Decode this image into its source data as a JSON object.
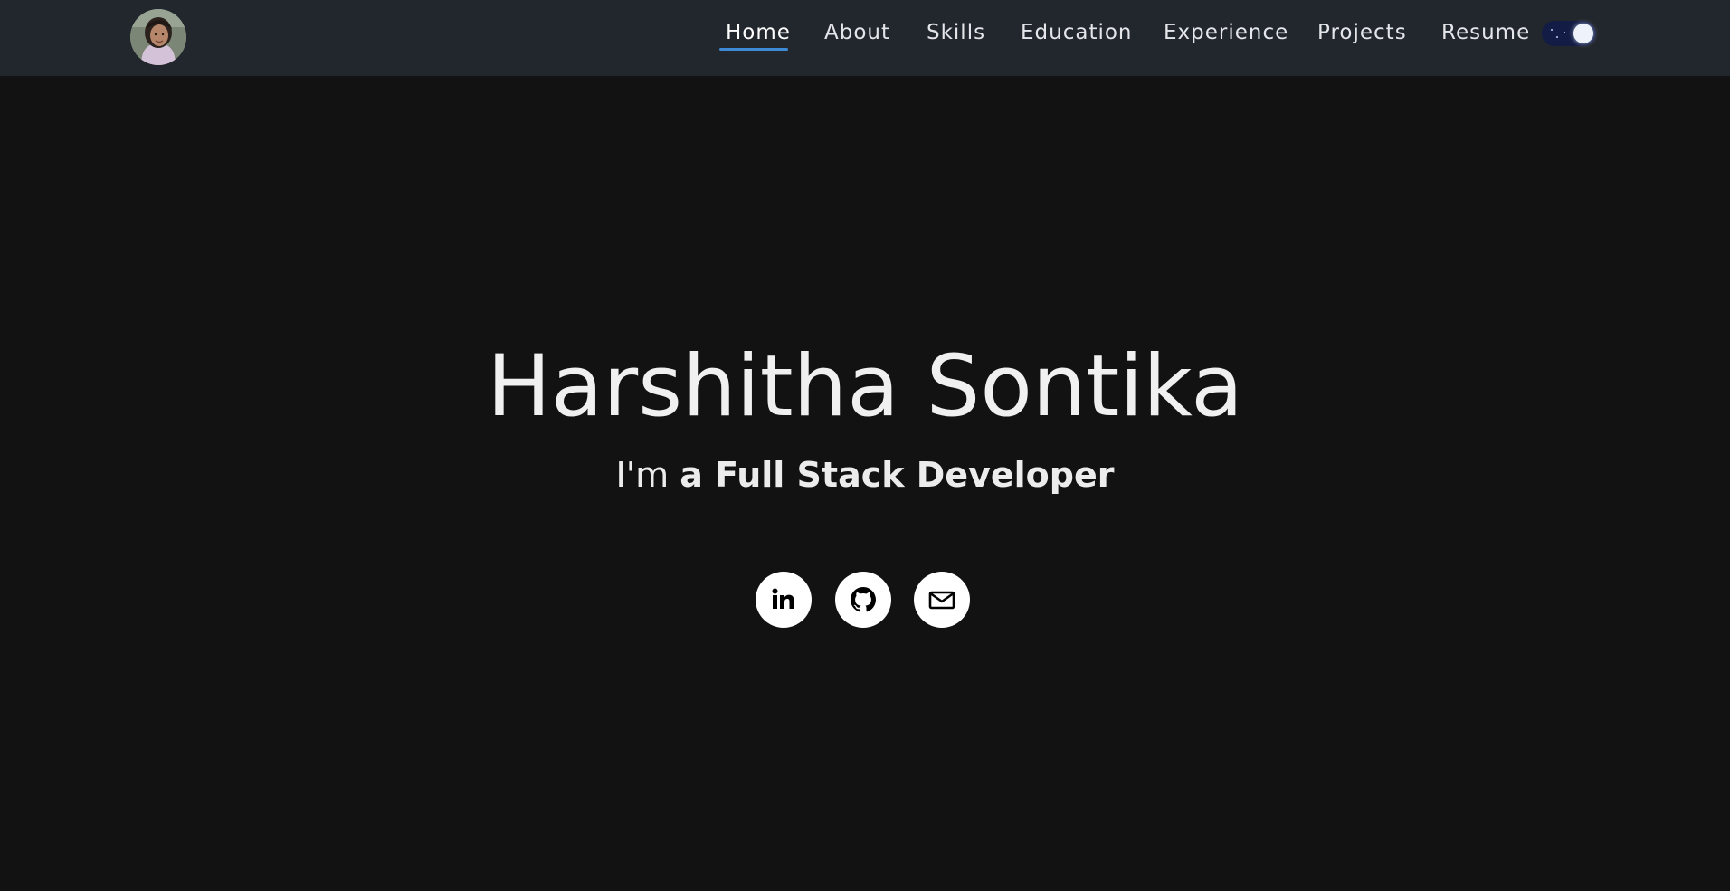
{
  "navbar": {
    "avatar_alt": "Harshitha Sontika profile photo",
    "links": [
      {
        "label": "Home",
        "active": true
      },
      {
        "label": "About",
        "active": false
      },
      {
        "label": "Skills",
        "active": false
      },
      {
        "label": "Education",
        "active": false
      },
      {
        "label": "Experience",
        "active": false
      },
      {
        "label": "Projects",
        "active": false
      },
      {
        "label": "Resume",
        "active": false
      }
    ],
    "theme_toggle": {
      "state": "dark",
      "icon": "moon-stars-icon"
    }
  },
  "hero": {
    "name": "Harshitha Sontika",
    "subtitle_lead": "I'm ",
    "subtitle_role": "a Full Stack Developer"
  },
  "socials": [
    {
      "icon": "linkedin-icon",
      "label": "LinkedIn"
    },
    {
      "icon": "github-icon",
      "label": "GitHub"
    },
    {
      "icon": "mail-icon",
      "label": "Email"
    }
  ],
  "colors": {
    "page_background": "#121212",
    "navbar_background": "#22262d",
    "active_underline": "#3f8ad6",
    "toggle_background": "#121c44",
    "text": "#ececec"
  }
}
